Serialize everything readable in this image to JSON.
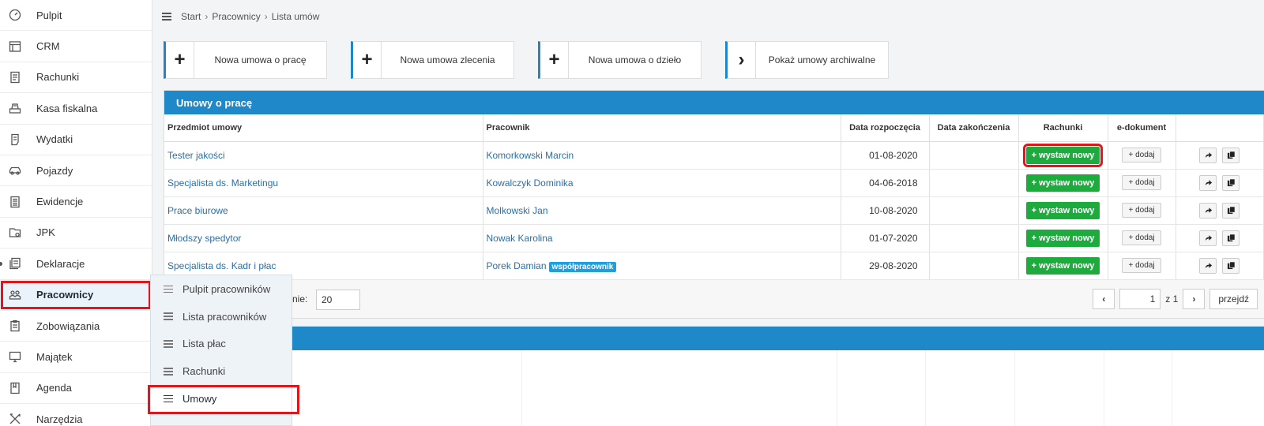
{
  "sidebar": {
    "items": [
      {
        "label": "Pulpit",
        "icon": "dashboard-icon"
      },
      {
        "label": "CRM",
        "icon": "crm-icon"
      },
      {
        "label": "Rachunki",
        "icon": "invoice-icon"
      },
      {
        "label": "Kasa fiskalna",
        "icon": "cash-register-icon"
      },
      {
        "label": "Wydatki",
        "icon": "expenses-icon"
      },
      {
        "label": "Pojazdy",
        "icon": "car-icon"
      },
      {
        "label": "Ewidencje",
        "icon": "records-icon"
      },
      {
        "label": "JPK",
        "icon": "jpk-icon"
      },
      {
        "label": "Deklaracje",
        "icon": "declarations-icon"
      },
      {
        "label": "Pracownicy",
        "icon": "employees-icon"
      },
      {
        "label": "Zobowiązania",
        "icon": "liabilities-icon"
      },
      {
        "label": "Majątek",
        "icon": "assets-icon"
      },
      {
        "label": "Agenda",
        "icon": "agenda-icon"
      },
      {
        "label": "Narzędzia",
        "icon": "tools-icon"
      }
    ],
    "active_index": 9
  },
  "breadcrumb": {
    "items": [
      "Start",
      "Pracownicy",
      "Lista umów"
    ]
  },
  "actions": [
    {
      "icon": "+",
      "label": "Nowa umowa o pracę"
    },
    {
      "icon": "+",
      "label": "Nowa umowa zlecenia"
    },
    {
      "icon": "+",
      "label": "Nowa umowa o dzieło"
    },
    {
      "icon": "›",
      "label": "Pokaż umowy archiwalne"
    }
  ],
  "contracts_panel": {
    "title": "Umowy o pracę",
    "columns": [
      "Przedmiot umowy",
      "Pracownik",
      "Data rozpoczęcia",
      "Data zakończenia",
      "Rachunki",
      "e-dokument",
      ""
    ],
    "rows": [
      {
        "subject": "Tester jakości",
        "employee": "Komorkowski Marcin",
        "badge": "",
        "start": "01-08-2020",
        "end": "",
        "invoice_btn": "+ wystaw nowy",
        "edoc_btn": "+ dodaj"
      },
      {
        "subject": "Specjalista ds. Marketingu",
        "employee": "Kowalczyk Dominika",
        "badge": "",
        "start": "04-06-2018",
        "end": "",
        "invoice_btn": "+ wystaw nowy",
        "edoc_btn": "+ dodaj"
      },
      {
        "subject": "Prace biurowe",
        "employee": "Molkowski Jan",
        "badge": "",
        "start": "10-08-2020",
        "end": "",
        "invoice_btn": "+ wystaw nowy",
        "edoc_btn": "+ dodaj"
      },
      {
        "subject": "Młodszy spedytor",
        "employee": "Nowak Karolina",
        "badge": "",
        "start": "01-07-2020",
        "end": "",
        "invoice_btn": "+ wystaw nowy",
        "edoc_btn": "+ dodaj"
      },
      {
        "subject": "Specjalista ds. Kadr i płac",
        "employee": "Porek Damian",
        "badge": "współpracownik",
        "start": "29-08-2020",
        "end": "",
        "invoice_btn": "+ wystaw nowy",
        "edoc_btn": "+ dodaj"
      }
    ],
    "footer": {
      "per_page_label": "nie:",
      "per_page_value": "20",
      "page_value": "1",
      "page_of": "z 1",
      "go_label": "przejdź"
    }
  },
  "submenu": {
    "items": [
      "Pulpit pracowników",
      "Lista pracowników",
      "Lista płac",
      "Rachunki",
      "Umowy"
    ],
    "active_index": 4
  },
  "colors": {
    "accent": "#1e88c9",
    "highlight": "#e0161b",
    "green": "#1eab3e"
  }
}
